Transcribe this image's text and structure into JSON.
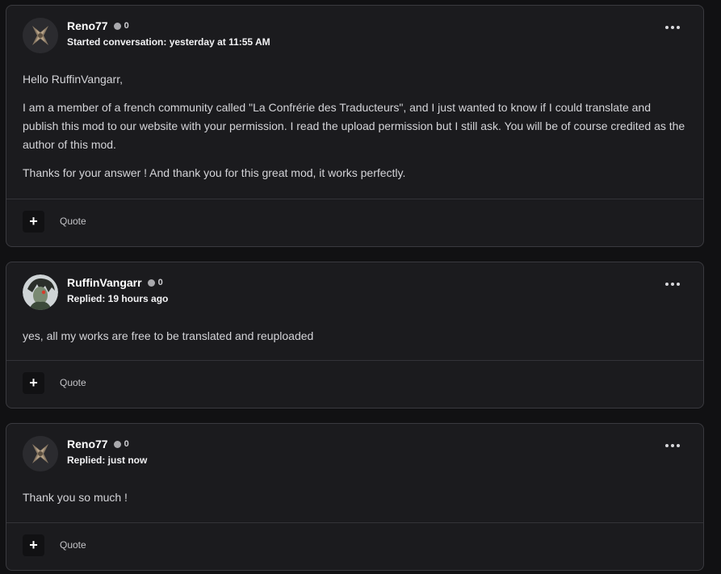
{
  "posts": [
    {
      "author": "Reno77",
      "reputation": "0",
      "meta": "Started conversation: yesterday at 11:55 AM",
      "avatar_icon": "crossed-swords-avatar",
      "paragraphs": [
        "Hello RuffinVangarr,",
        "I am a member of a french community called \"La Confrérie des Traducteurs\", and I just wanted to know if I could translate and publish this mod to our website with your permission. I read the upload permission but I still ask. You will be of course credited as the author of this mod.",
        "Thanks for your answer ! And thank you for this great mod, it works perfectly."
      ],
      "plus_label": "+",
      "quote_label": "Quote"
    },
    {
      "author": "RuffinVangarr",
      "reputation": "0",
      "meta": "Replied: 19 hours ago",
      "avatar_icon": "character-portrait-avatar",
      "paragraphs": [
        "yes, all my works are free to be translated and reuploaded"
      ],
      "plus_label": "+",
      "quote_label": "Quote"
    },
    {
      "author": "Reno77",
      "reputation": "0",
      "meta": "Replied: just now",
      "avatar_icon": "crossed-swords-avatar",
      "paragraphs": [
        "Thank you so much !"
      ],
      "plus_label": "+",
      "quote_label": "Quote"
    }
  ]
}
